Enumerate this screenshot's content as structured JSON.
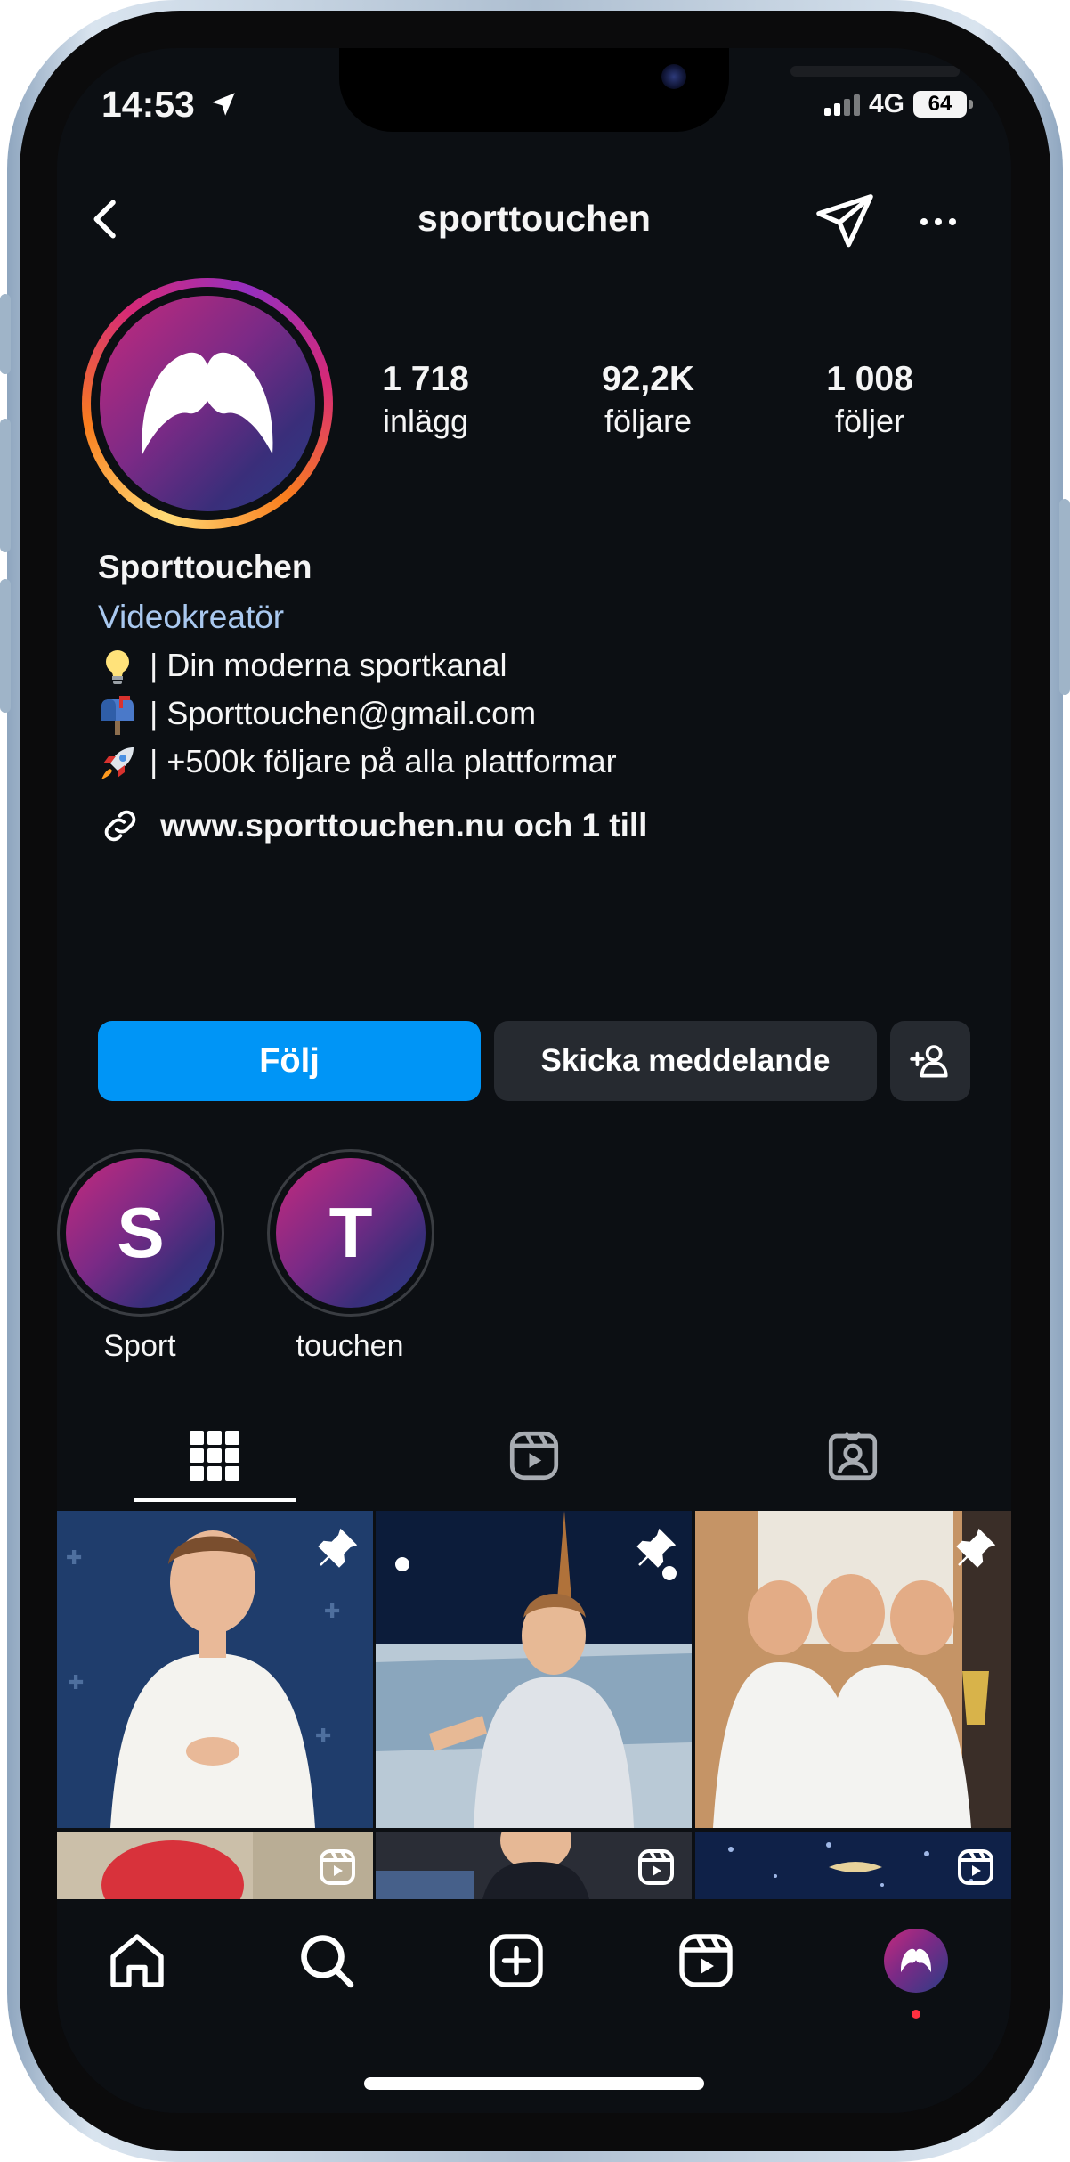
{
  "status_bar": {
    "time": "14:53",
    "network": "4G",
    "battery": "64"
  },
  "header": {
    "username": "sporttouchen"
  },
  "profile": {
    "stats": [
      {
        "value": "1 718",
        "label": "inlägg"
      },
      {
        "value": "92,2K",
        "label": "följare"
      },
      {
        "value": "1 008",
        "label": "följer"
      }
    ],
    "name": "Sporttouchen",
    "category": "Videokreatör",
    "bio_lines": [
      {
        "emoji": "light-bulb",
        "text": "| Din moderna sportkanal"
      },
      {
        "emoji": "mailbox",
        "text": "| Sporttouchen@gmail.com"
      },
      {
        "emoji": "rocket",
        "text": "| +500k följare på alla plattformar"
      }
    ],
    "link": "www.sporttouchen.nu och 1 till"
  },
  "actions": {
    "follow": "Följ",
    "message": "Skicka meddelande"
  },
  "highlights": [
    {
      "letter": "S",
      "label": "Sport"
    },
    {
      "letter": "T",
      "label": "touchen"
    }
  ],
  "colors": {
    "accent": "#0095f6",
    "category": "#a9c8ef",
    "background": "#0c0f13"
  }
}
